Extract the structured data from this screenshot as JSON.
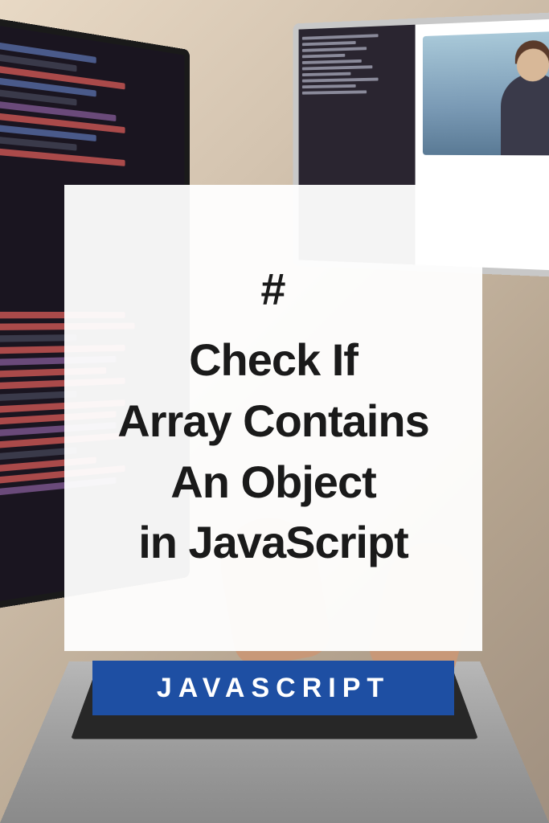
{
  "card": {
    "hash": "#",
    "title_line1": "Check If",
    "title_line2": "Array Contains",
    "title_line3": "An Object",
    "title_line4": "in JavaScript"
  },
  "badge": {
    "label": "JAVASCRIPT"
  },
  "colors": {
    "badge_bg": "#1e4fa3",
    "card_bg": "rgba(255,255,255,0.95)",
    "text": "#1a1a1a"
  }
}
